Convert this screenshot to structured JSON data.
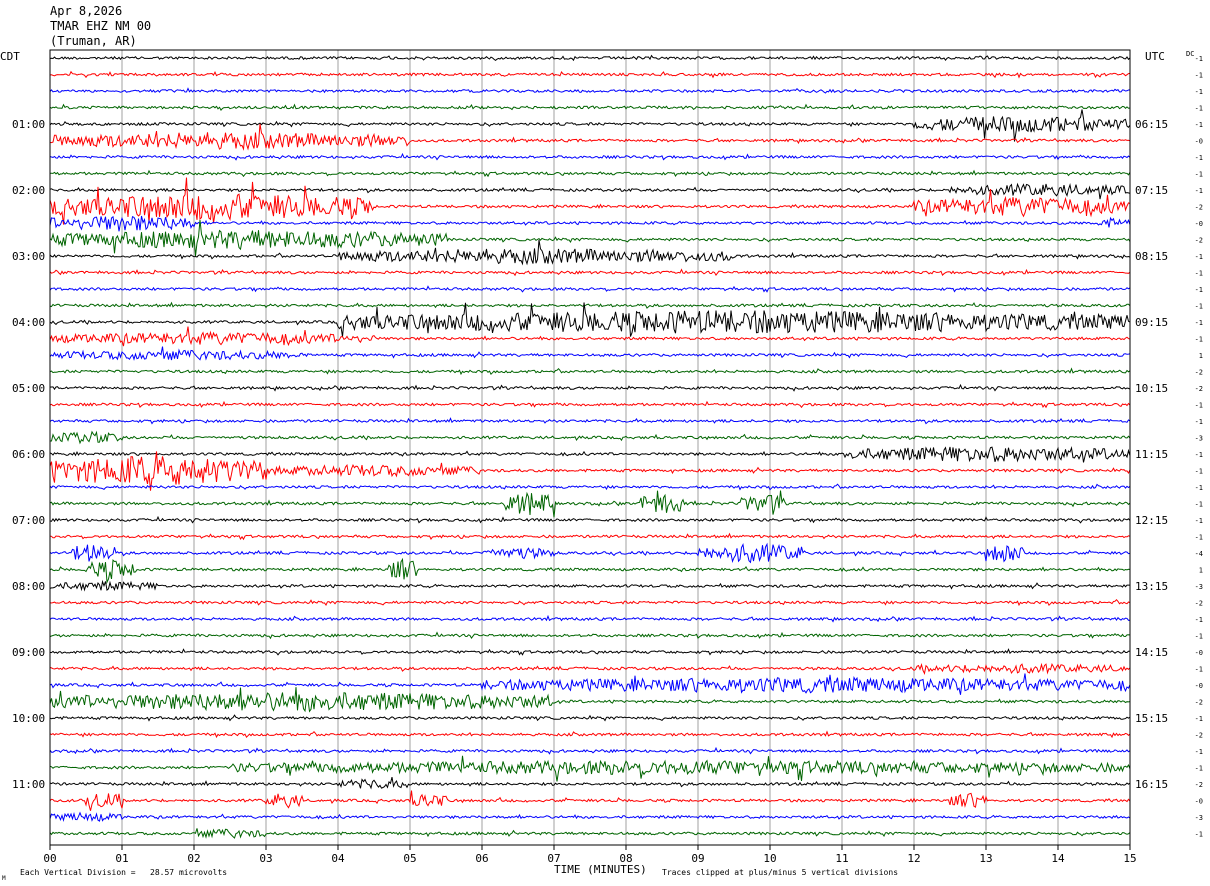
{
  "header": {
    "date": "Apr 8,2026",
    "station": "TMAR EHZ NM 00",
    "location": "(Truman, AR)"
  },
  "axes": {
    "left_tz": "CDT",
    "right_tz": "UTC",
    "dc_label": "DC",
    "x_title": "TIME (MINUTES)"
  },
  "footer": {
    "scale": "Each Vertical Division =   28.57 microvolts",
    "clip": "Traces clipped at plus/minus 5 vertical divisions",
    "corner": "M"
  },
  "chart_data": {
    "type": "helicorder",
    "title": "Apr 8,2026",
    "xlabel": "TIME (MINUTES)",
    "x_ticks": [
      "00",
      "01",
      "02",
      "03",
      "04",
      "05",
      "06",
      "07",
      "08",
      "09",
      "10",
      "11",
      "12",
      "13",
      "14",
      "15"
    ],
    "xlim": [
      0,
      15
    ],
    "minutes_per_line": 15,
    "line_count": 48,
    "trace_colors": [
      "#000000",
      "#ff0000",
      "#0000ff",
      "#006400"
    ],
    "left_time_labels": [
      {
        "line": 4,
        "text": "01:00"
      },
      {
        "line": 8,
        "text": "02:00"
      },
      {
        "line": 12,
        "text": "03:00"
      },
      {
        "line": 16,
        "text": "04:00"
      },
      {
        "line": 20,
        "text": "05:00"
      },
      {
        "line": 24,
        "text": "06:00"
      },
      {
        "line": 28,
        "text": "07:00"
      },
      {
        "line": 32,
        "text": "08:00"
      },
      {
        "line": 36,
        "text": "09:00"
      },
      {
        "line": 40,
        "text": "10:00"
      },
      {
        "line": 44,
        "text": "11:00"
      }
    ],
    "right_time_labels": [
      {
        "line": 4,
        "text": "06:15"
      },
      {
        "line": 8,
        "text": "07:15"
      },
      {
        "line": 12,
        "text": "08:15"
      },
      {
        "line": 16,
        "text": "09:15"
      },
      {
        "line": 20,
        "text": "10:15"
      },
      {
        "line": 24,
        "text": "11:15"
      },
      {
        "line": 28,
        "text": "12:15"
      },
      {
        "line": 32,
        "text": "13:15"
      },
      {
        "line": 36,
        "text": "14:15"
      },
      {
        "line": 40,
        "text": "15:15"
      },
      {
        "line": 44,
        "text": "16:15"
      }
    ],
    "dc_offsets": [
      "-1",
      "-1",
      "-1",
      "-1",
      "-1",
      "-0",
      "-1",
      "-1",
      "-1",
      "-2",
      "-0",
      "-2",
      "-1",
      "-1",
      "-1",
      "-1",
      "-1",
      "-1",
      "1",
      "-2",
      "-2",
      "-1",
      "-1",
      "-3",
      "-1",
      "-1",
      "-1",
      "-1",
      "-1",
      "-1",
      "-4",
      "1",
      "-3",
      "-2",
      "-1",
      "-1",
      "-0",
      "-1",
      "-0",
      "-2",
      "-1",
      "-2",
      "-1",
      "-1",
      "-2",
      "-0",
      "-3",
      "-1"
    ],
    "activity": [
      {
        "line": 4,
        "from": 12.0,
        "to": 15.0,
        "amp": 2.2
      },
      {
        "line": 5,
        "from": 0.0,
        "to": 5.0,
        "amp": 2.2
      },
      {
        "line": 8,
        "from": 12.5,
        "to": 15.0,
        "amp": 1.6
      },
      {
        "line": 9,
        "from": 0.0,
        "to": 4.5,
        "amp": 3.5
      },
      {
        "line": 9,
        "from": 12.0,
        "to": 15.0,
        "amp": 2.5
      },
      {
        "line": 10,
        "from": 0.0,
        "to": 2.0,
        "amp": 2.2
      },
      {
        "line": 10,
        "from": 14.5,
        "to": 15.0,
        "amp": 1.3
      },
      {
        "line": 11,
        "from": 0.0,
        "to": 5.5,
        "amp": 2.5
      },
      {
        "line": 12,
        "from": 4.0,
        "to": 9.5,
        "amp": 2.0
      },
      {
        "line": 16,
        "from": 4.0,
        "to": 15.0,
        "amp": 3.0
      },
      {
        "line": 17,
        "from": 0.0,
        "to": 4.5,
        "amp": 1.6
      },
      {
        "line": 18,
        "from": 0.0,
        "to": 3.5,
        "amp": 1.3
      },
      {
        "line": 23,
        "from": 0.0,
        "to": 1.0,
        "amp": 1.5
      },
      {
        "line": 24,
        "from": 11.0,
        "to": 15.0,
        "amp": 2.0
      },
      {
        "line": 25,
        "from": 0.0,
        "to": 3.0,
        "amp": 4.0
      },
      {
        "line": 25,
        "from": 3.0,
        "to": 6.0,
        "amp": 1.5
      },
      {
        "line": 27,
        "from": 6.3,
        "to": 7.0,
        "amp": 3.0
      },
      {
        "line": 27,
        "from": 8.2,
        "to": 8.8,
        "amp": 3.0
      },
      {
        "line": 27,
        "from": 9.6,
        "to": 10.2,
        "amp": 2.5
      },
      {
        "line": 30,
        "from": 0.3,
        "to": 0.9,
        "amp": 2.5
      },
      {
        "line": 30,
        "from": 6.0,
        "to": 7.0,
        "amp": 1.5
      },
      {
        "line": 30,
        "from": 9.0,
        "to": 10.5,
        "amp": 2.5
      },
      {
        "line": 30,
        "from": 13.0,
        "to": 13.5,
        "amp": 2.5
      },
      {
        "line": 31,
        "from": 0.5,
        "to": 1.2,
        "amp": 2.5
      },
      {
        "line": 31,
        "from": 4.7,
        "to": 5.1,
        "amp": 3.0
      },
      {
        "line": 32,
        "from": 0.0,
        "to": 1.5,
        "amp": 1.2
      },
      {
        "line": 37,
        "from": 12.0,
        "to": 15.0,
        "amp": 1.2
      },
      {
        "line": 38,
        "from": 6.0,
        "to": 15.0,
        "amp": 2.0
      },
      {
        "line": 39,
        "from": 0.0,
        "to": 7.0,
        "amp": 2.5
      },
      {
        "line": 43,
        "from": 2.5,
        "to": 15.0,
        "amp": 1.8
      },
      {
        "line": 44,
        "from": 4.0,
        "to": 5.0,
        "amp": 1.3
      },
      {
        "line": 45,
        "from": 0.5,
        "to": 1.0,
        "amp": 2.0
      },
      {
        "line": 45,
        "from": 3.0,
        "to": 3.5,
        "amp": 2.0
      },
      {
        "line": 45,
        "from": 5.0,
        "to": 5.5,
        "amp": 2.0
      },
      {
        "line": 45,
        "from": 12.5,
        "to": 13.0,
        "amp": 2.0
      },
      {
        "line": 46,
        "from": 0.0,
        "to": 1.0,
        "amp": 1.2
      },
      {
        "line": 47,
        "from": 2.0,
        "to": 3.0,
        "amp": 1.2
      }
    ]
  }
}
